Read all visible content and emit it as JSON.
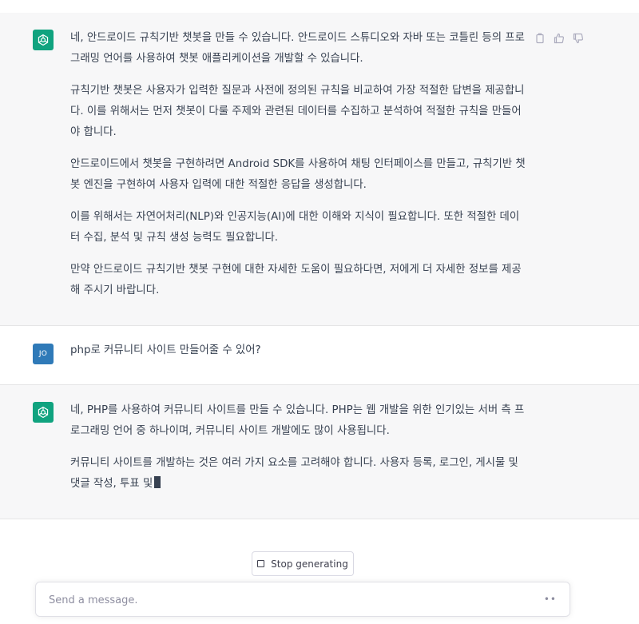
{
  "conversation": {
    "assistant_1": {
      "paragraphs": [
        "네, 안드로이드 규칙기반 챗봇을 만들 수 있습니다. 안드로이드 스튜디오와 자바 또는 코틀린 등의 프로그래밍 언어를 사용하여 챗봇 애플리케이션을 개발할 수 있습니다.",
        "규칙기반 챗봇은 사용자가 입력한 질문과 사전에 정의된 규칙을 비교하여 가장 적절한 답변을 제공합니다. 이를 위해서는 먼저 챗봇이 다룰 주제와 관련된 데이터를 수집하고 분석하여 적절한 규칙을 만들어야 합니다.",
        "안드로이드에서 챗봇을 구현하려면 Android SDK를 사용하여 채팅 인터페이스를 만들고, 규칙기반 챗봇 엔진을 구현하여 사용자 입력에 대한 적절한 응답을 생성합니다.",
        "이를 위해서는 자연어처리(NLP)와 인공지능(AI)에 대한 이해와 지식이 필요합니다. 또한 적절한 데이터 수집, 분석 및 규칙 생성 능력도 필요합니다.",
        "만약 안드로이드 규칙기반 챗봇 구현에 대한 자세한 도움이 필요하다면, 저에게 더 자세한 정보를 제공해 주시기 바랍니다."
      ]
    },
    "user_1": {
      "avatar_initials": "JO",
      "text": "php로 커뮤니티 사이트 만들어줄 수 있어?"
    },
    "assistant_2": {
      "paragraphs": [
        "네, PHP를 사용하여 커뮤니티 사이트를 만들 수 있습니다. PHP는 웹 개발을 위한 인기있는 서버 측 프로그래밍 언어 중 하나이며, 커뮤니티 사이트 개발에도 많이 사용됩니다.",
        "커뮤니티 사이트를 개발하는 것은 여러 가지 요소를 고려해야 합니다. 사용자 등록, 로그인, 게시물 및 댓글 작성, 투표 및"
      ]
    }
  },
  "message_actions": [
    "copy-icon",
    "thumbs-up-icon",
    "thumbs-down-icon"
  ],
  "stop_button": {
    "label": "Stop generating"
  },
  "composer": {
    "placeholder": "Send a message.",
    "value": ""
  },
  "colors": {
    "assistant_bg": "#f7f7f8",
    "bot_avatar": "#10a37f",
    "user_avatar": "#2f7ab8",
    "text": "#374151"
  }
}
